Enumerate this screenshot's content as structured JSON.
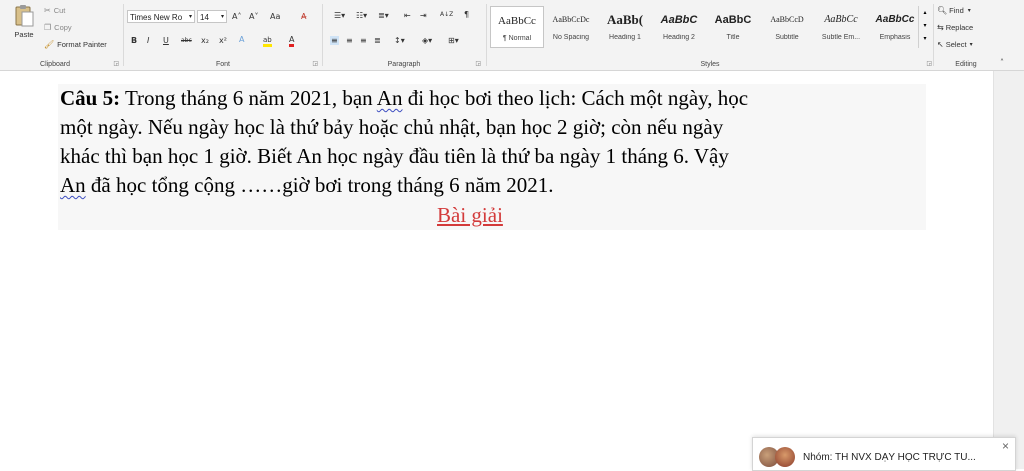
{
  "ribbon": {
    "clipboard": {
      "label": "Clipboard",
      "paste": "Paste",
      "cut": "Cut",
      "copy": "Copy",
      "format_painter": "Format Painter"
    },
    "font": {
      "label": "Font",
      "name": "Times New Ro",
      "size": "14",
      "bold": "B",
      "italic": "I",
      "underline": "U",
      "strike": "abc",
      "subscript": "x₂",
      "superscript": "x²",
      "grow": "A˄",
      "shrink": "A˅",
      "change_case": "Aa",
      "clear": "A̶",
      "font_color": "A",
      "highlight": "ab"
    },
    "paragraph": {
      "label": "Paragraph",
      "sort": "A↓Z",
      "pilcrow": "¶"
    },
    "styles": {
      "label": "Styles",
      "items": [
        {
          "sample": "AaBbCc",
          "name": "¶ Normal"
        },
        {
          "sample": "AaBbCcDc",
          "name": "No Spacing"
        },
        {
          "sample": "AaBb(",
          "name": "Heading 1"
        },
        {
          "sample": "AaBbC",
          "name": "Heading 2"
        },
        {
          "sample": "AaBbC",
          "name": "Title"
        },
        {
          "sample": "AaBbCcD",
          "name": "Subtitle"
        },
        {
          "sample": "AaBbCc",
          "name": "Subtle Em..."
        },
        {
          "sample": "AaBbCc",
          "name": "Emphasis"
        }
      ]
    },
    "editing": {
      "label": "Editing",
      "find": "Find",
      "replace": "Replace",
      "select": "Select"
    }
  },
  "document": {
    "line1_bold": "Câu 5:",
    "line1_a": " Trong tháng 6 năm 2021, bạn ",
    "line1_name": "An",
    "line1_b": " đi học bơi theo lịch: Cách một ngày, học",
    "line2": "một ngày. Nếu ngày học là thứ bảy hoặc chủ nhật, bạn học 2 giờ; còn nếu ngày",
    "line3": "khác thì bạn học 1 giờ. Biết An học ngày đầu tiên là thứ ba ngày 1 tháng 6. Vậy",
    "line4_name": "An",
    "line4_rest": " đã học tổng cộng ……giờ bơi trong tháng 6 năm 2021.",
    "solution_heading": "Bài giải"
  },
  "panel": {
    "group_name": "Nhóm: TH NVX DẠY HỌC TRỰC TU...",
    "close": "×"
  },
  "colors": {
    "ribbon_bg": "#f3f3f3",
    "solution_red": "#d33a3a",
    "spell_underline": "#3b4cc0"
  }
}
